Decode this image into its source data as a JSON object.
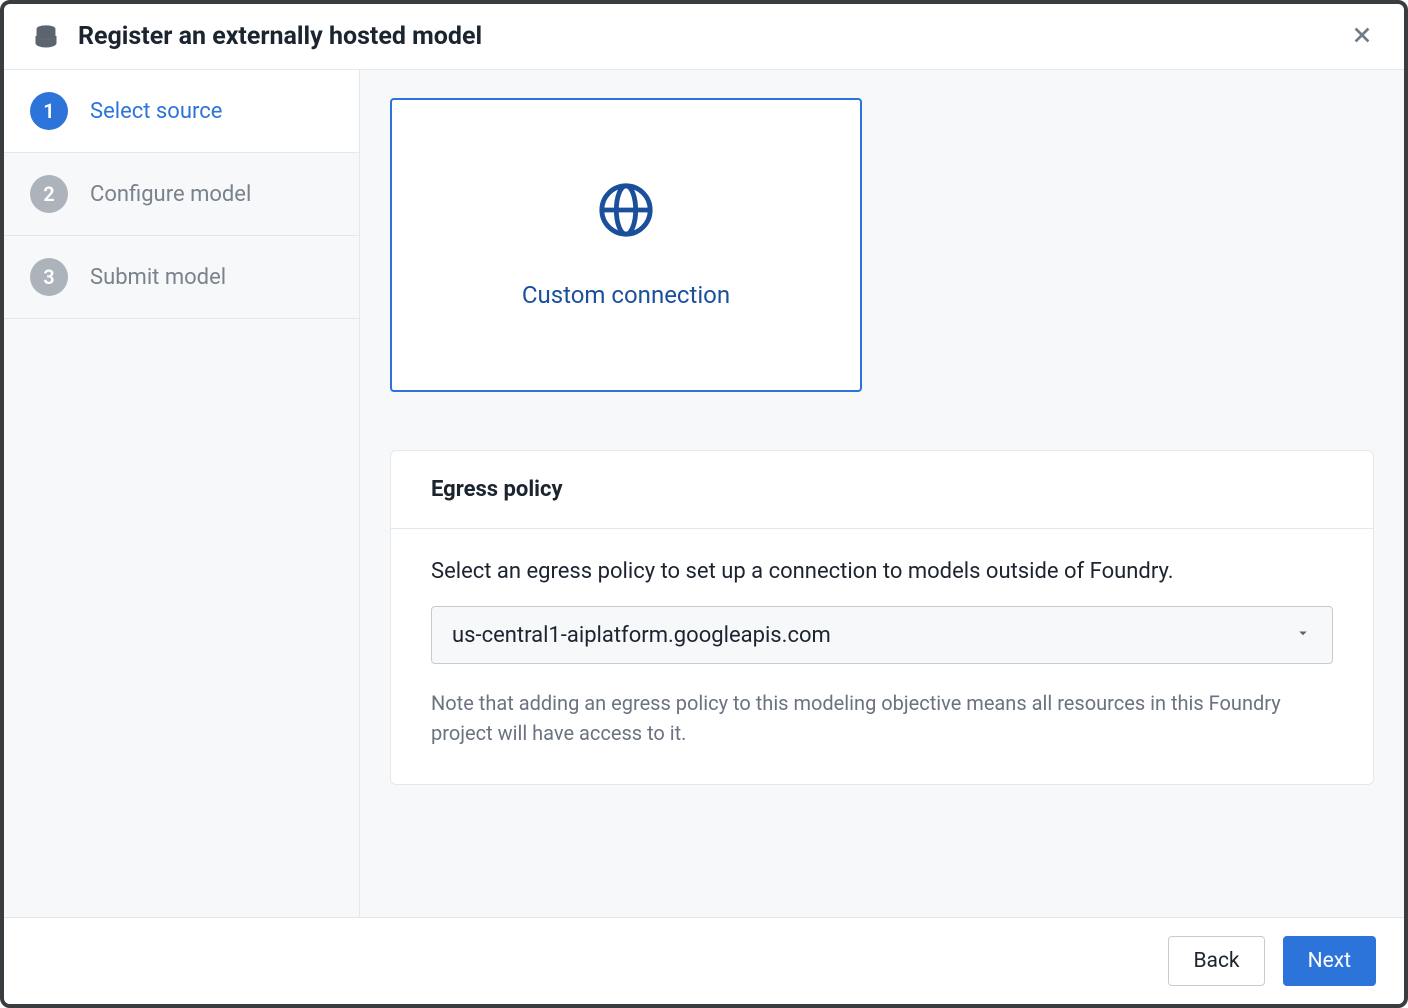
{
  "header": {
    "title": "Register an externally hosted model"
  },
  "stepper": {
    "steps": [
      {
        "num": "1",
        "label": "Select source",
        "active": true
      },
      {
        "num": "2",
        "label": "Configure model",
        "active": false
      },
      {
        "num": "3",
        "label": "Submit model",
        "active": false
      }
    ]
  },
  "source_card": {
    "label": "Custom connection"
  },
  "egress": {
    "title": "Egress policy",
    "description": "Select an egress policy to set up a connection to models outside of Foundry.",
    "selected": "us-central1-aiplatform.googleapis.com",
    "note": "Note that adding an egress policy to this modeling objective means all resources in this Foundry project will have access to it."
  },
  "footer": {
    "back": "Back",
    "next": "Next"
  }
}
